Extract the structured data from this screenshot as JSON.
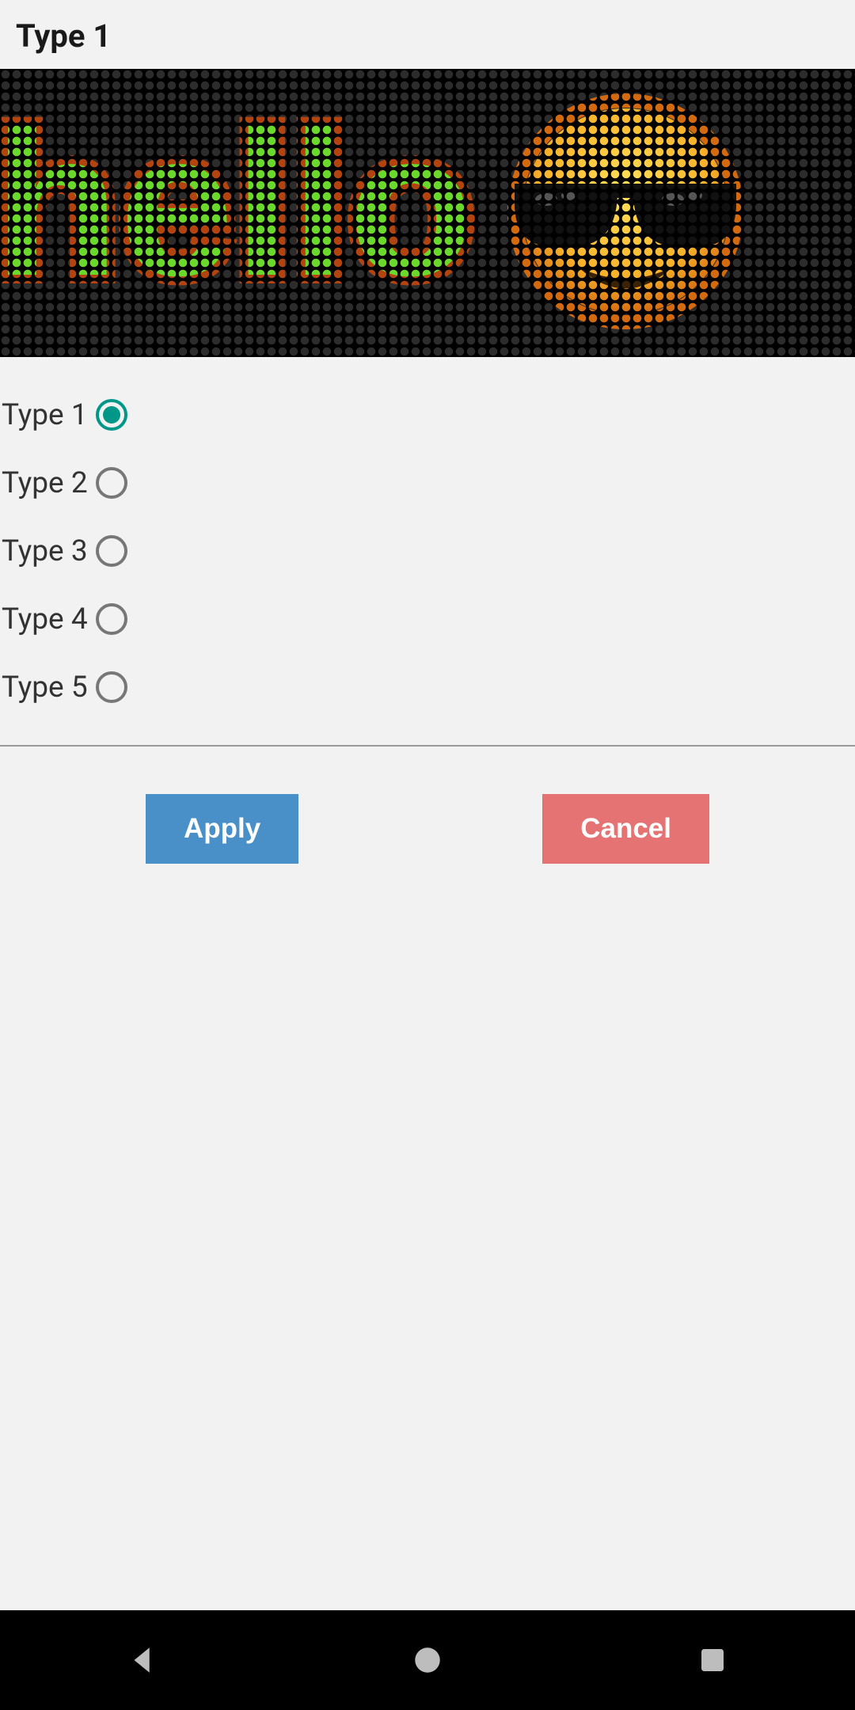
{
  "header": {
    "title": "Type 1"
  },
  "preview": {
    "text": "hello",
    "emoji": "cool-face-sunglasses"
  },
  "options": [
    {
      "label": "Type 1",
      "checked": true
    },
    {
      "label": "Type 2",
      "checked": false
    },
    {
      "label": "Type 3",
      "checked": false
    },
    {
      "label": "Type 4",
      "checked": false
    },
    {
      "label": "Type 5",
      "checked": false
    }
  ],
  "buttons": {
    "apply": "Apply",
    "cancel": "Cancel"
  },
  "colors": {
    "accent": "#009688",
    "apply": "#4a90c8",
    "cancel": "#e57373",
    "led_text": "#6bd82c",
    "led_halo": "#b34410"
  }
}
